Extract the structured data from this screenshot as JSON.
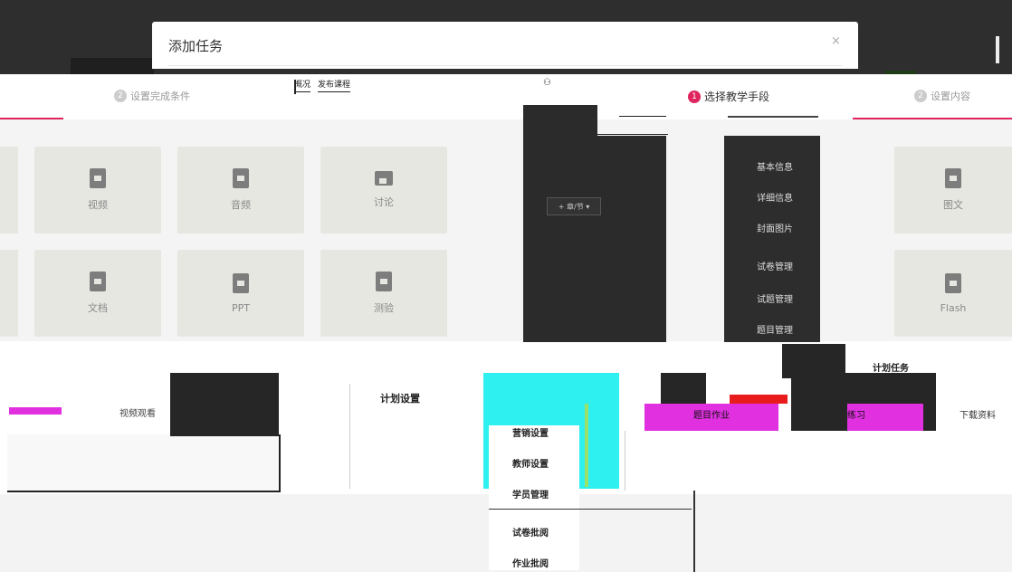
{
  "modal": {
    "title": "添加任务",
    "close": "×"
  },
  "steps": {
    "active_num": "1",
    "active_label": "选择教学手段",
    "left_label": "设置完成条件",
    "left_num": "2",
    "right_label": "设置内容",
    "right_num": "2"
  },
  "mini_tabs": [
    "概况",
    "发布课程"
  ],
  "tiles": [
    {
      "label": "视频",
      "icon": "video-file-icon"
    },
    {
      "label": "音频",
      "icon": "audio-file-icon"
    },
    {
      "label": "讨论",
      "icon": "discussion-icon"
    },
    {
      "label": "图文",
      "icon": "image-text-icon"
    },
    {
      "label": "文档",
      "icon": "document-icon"
    },
    {
      "label": "PPT",
      "icon": "ppt-icon"
    },
    {
      "label": "测验",
      "icon": "quiz-icon"
    },
    {
      "label": "Flash",
      "icon": "flash-icon"
    }
  ],
  "chapter_button": "+ 章/节 ▾",
  "course_menu": [
    "基本信息",
    "详细信息",
    "封面图片",
    "试卷管理",
    "试题管理",
    "题目管理"
  ],
  "bottom": {
    "plan_settings": "计划设置",
    "plan_tasks": "计划任务",
    "tab_homework": "题目作业",
    "tab_practice": "练习",
    "tab_download": "下载资料",
    "tab_video": "视频观看",
    "side_menu": [
      "营销设置",
      "教师设置",
      "学员管理",
      "试卷批阅",
      "作业批阅"
    ]
  }
}
